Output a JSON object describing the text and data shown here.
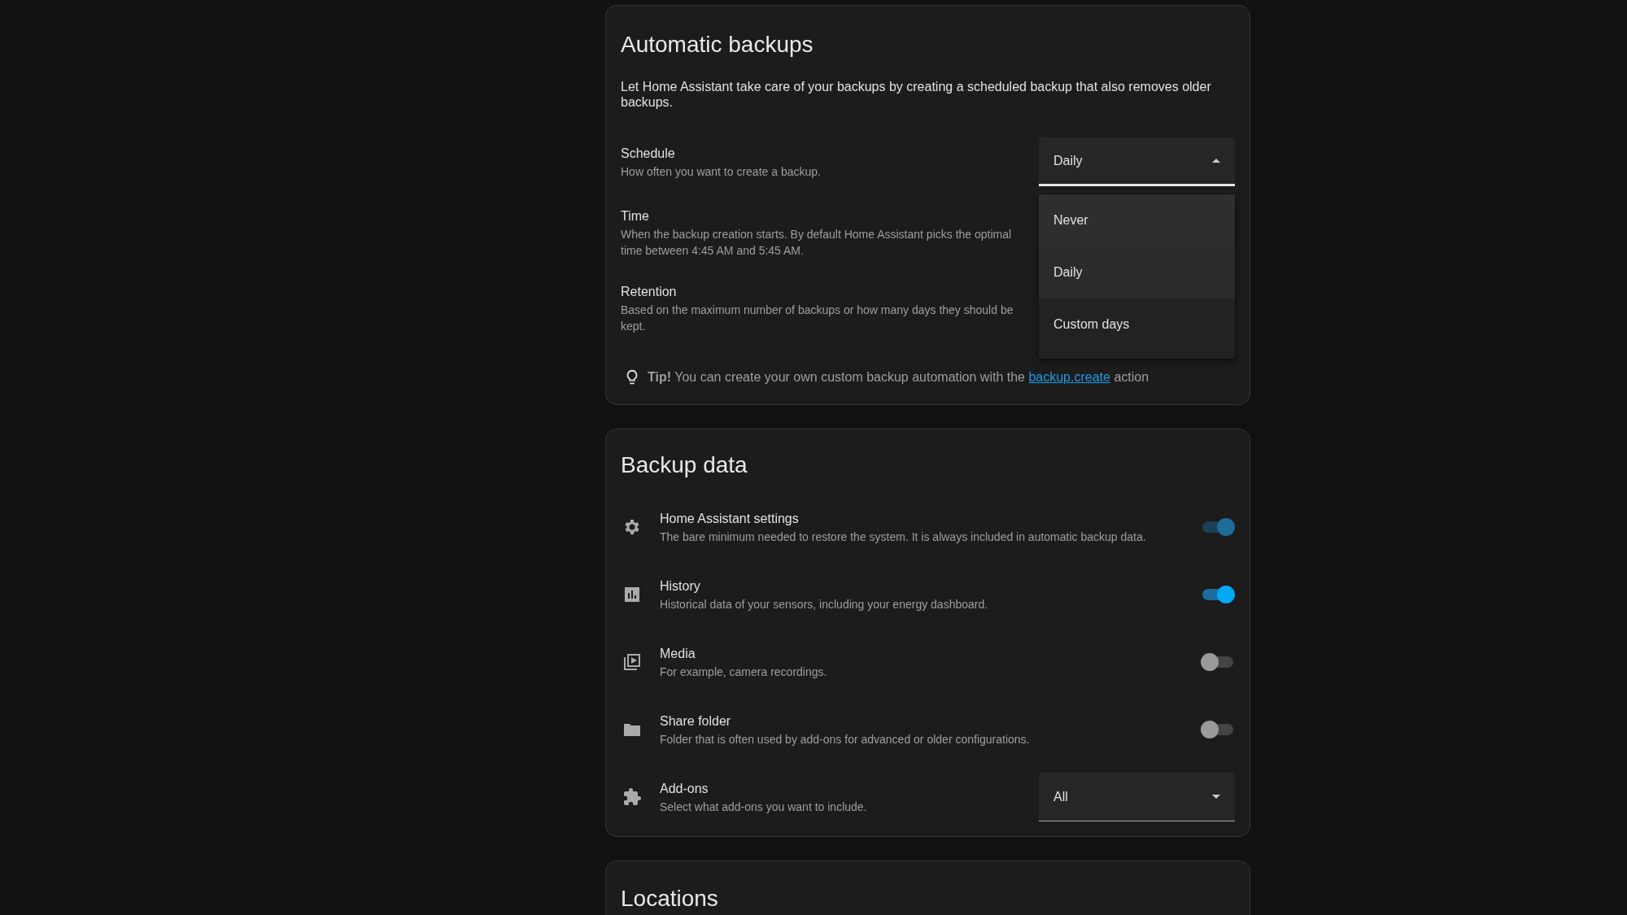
{
  "automatic_backups": {
    "title": "Automatic backups",
    "description": "Let Home Assistant take care of your backups by creating a scheduled backup that also removes older backups.",
    "settings": [
      {
        "label": "Schedule",
        "description": "How often you want to create a backup."
      },
      {
        "label": "Time",
        "description": "When the backup creation starts. By default Home Assistant picks the optimal time between 4:45 AM and 5:45 AM."
      },
      {
        "label": "Retention",
        "description": "Based on the maximum number of backups or how many days they should be kept."
      }
    ],
    "schedule_select": {
      "value": "Daily",
      "expanded": true,
      "options": [
        {
          "label": "Never",
          "selected": false,
          "hovered": true
        },
        {
          "label": "Daily",
          "selected": true,
          "hovered": false
        },
        {
          "label": "Custom days",
          "selected": false,
          "hovered": false
        }
      ]
    },
    "tip": {
      "text": "**Tip!** You can create your own custom backup automation with the",
      "link": "backup.create",
      "suffix": "action"
    }
  },
  "backup_data": {
    "title": "Backup data",
    "items": [
      {
        "kind": "toggle",
        "label": "Home Assistant settings",
        "description": "The bare minimum needed to restore the system. It is always included in automatic backup data.",
        "on": true,
        "disabled": true
      },
      {
        "kind": "toggle",
        "label": "History",
        "description": "Historical data of your sensors, including your energy dashboard.",
        "on": true,
        "disabled": false
      },
      {
        "kind": "toggle",
        "label": "Media",
        "description": "For example, camera recordings.",
        "on": false,
        "disabled": false
      },
      {
        "kind": "toggle",
        "label": "Share folder",
        "description": "Folder that is often used by add-ons for advanced or older configurations.",
        "on": false,
        "disabled": false
      },
      {
        "kind": "select",
        "label": "Add-ons",
        "description": "Select what add-ons you want to include.",
        "value": "All",
        "expanded": false
      }
    ]
  },
  "locations": {
    "title": "Locations"
  }
}
